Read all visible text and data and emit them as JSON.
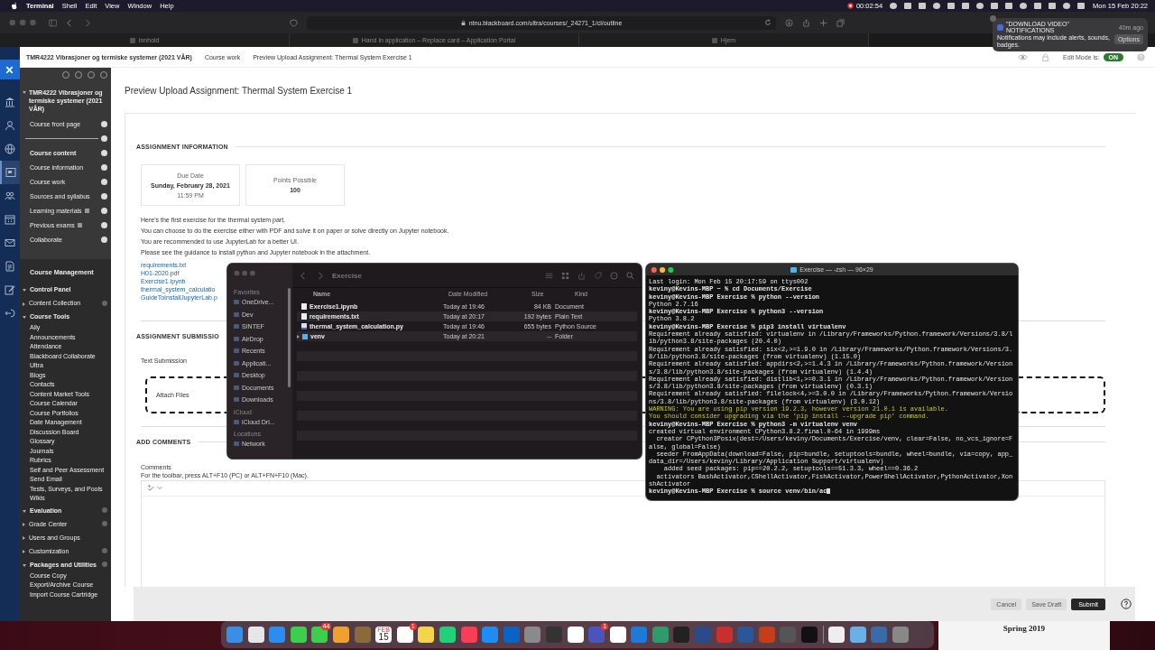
{
  "menubar": {
    "app": "Terminal",
    "menus": [
      "Shell",
      "Edit",
      "View",
      "Window",
      "Help"
    ],
    "recording_time": "00:02:54",
    "clock": "Mon 15 Feb 20:22"
  },
  "browser": {
    "url": "ntnu.blackboard.com/ultra/courses/_24271_1/cl/outline",
    "tabs": [
      "Innhold",
      "Hand in application – Replace card – Application Portal",
      "Hjem"
    ]
  },
  "notification": {
    "title": "\"DOWNLOAD VIDEO\" NOTIFICATIONS",
    "time": "40m ago",
    "body": "Notifications may include alerts, sounds, badges.",
    "action": "Options"
  },
  "header": {
    "breadcrumbs": [
      "TMR4222 Vibrasjoner og termiske systemer (2021 VÅR)",
      "Course work",
      "Preview Upload Assignment: Thermal System Exercise 1"
    ],
    "edit_mode_label": "Edit Mode is:",
    "edit_mode": {
      "on": true,
      "label": "ON"
    }
  },
  "course_menu": {
    "title": "TMR4222 Vibrasjoner og termiske systemer (2021 VÅR)",
    "items": [
      {
        "kind": "link",
        "label": "Course front page",
        "hidden": false
      },
      {
        "kind": "divider",
        "hidden": false
      },
      {
        "kind": "heading",
        "label": "Course content",
        "hidden": false
      },
      {
        "kind": "link",
        "label": "Course information",
        "hidden": false
      },
      {
        "kind": "link",
        "label": "Course work",
        "hidden": false
      },
      {
        "kind": "link",
        "label": "Sources and syllabus",
        "hidden": false
      },
      {
        "kind": "link",
        "label": "Learning materials",
        "hidden": true
      },
      {
        "kind": "link",
        "label": "Previous exams",
        "hidden": true
      },
      {
        "kind": "link",
        "label": "Collaborate",
        "hidden": false
      }
    ]
  },
  "course_management": {
    "title": "Course Management",
    "sections": [
      {
        "label": "Control Panel",
        "expanded": true,
        "menu": false,
        "children": [
          {
            "label": "Content Collection",
            "expanded": false,
            "menu": true
          },
          {
            "label": "Course Tools",
            "expanded": true,
            "menu": false,
            "children": [
              {
                "label": "Ally"
              },
              {
                "label": "Announcements"
              },
              {
                "label": "Attendance"
              },
              {
                "label": "Blackboard Collaborate Ultra"
              },
              {
                "label": "Blogs"
              },
              {
                "label": "Contacts"
              },
              {
                "label": "Content Market Tools"
              },
              {
                "label": "Course Calendar"
              },
              {
                "label": "Course Portfolios"
              },
              {
                "label": "Date Management"
              },
              {
                "label": "Discussion Board"
              },
              {
                "label": "Glossary"
              },
              {
                "label": "Journals"
              },
              {
                "label": "Rubrics"
              },
              {
                "label": "Self and Peer Assessment"
              },
              {
                "label": "Send Email"
              },
              {
                "label": "Tests, Surveys, and Pools"
              },
              {
                "label": "Wikis"
              }
            ]
          },
          {
            "label": "Evaluation",
            "expanded": true,
            "menu": true
          },
          {
            "label": "Grade Center",
            "expanded": false,
            "menu": true
          },
          {
            "label": "Users and Groups",
            "expanded": false,
            "menu": false
          },
          {
            "label": "Customization",
            "expanded": false,
            "menu": true
          },
          {
            "label": "Packages and Utilities",
            "expanded": true,
            "menu": true,
            "children": [
              {
                "label": "Course Copy"
              },
              {
                "label": "Export/Archive Course"
              },
              {
                "label": "Import Course Cartridge"
              }
            ]
          }
        ]
      }
    ]
  },
  "main": {
    "title": "Preview Upload Assignment: Thermal System Exercise 1",
    "info_heading": "ASSIGNMENT INFORMATION",
    "due": {
      "label": "Due Date",
      "date": "Sunday, February 28, 2021",
      "time": "11:59 PM"
    },
    "points": {
      "label": "Points Possible",
      "value": "100"
    },
    "instructions": [
      "Here's the first exercise for the thermal system part.",
      "You can choose to do the exercise either with PDF and solve it on paper or solve directly on Jupyter notebook.",
      "You are recommended to use JupyterLab for a better UI.",
      "Please see the guidance to install python and Jupyter notebook in the attachment."
    ],
    "attachments": [
      "requirements.txt",
      "H01-2020.pdf",
      "Exercise1.ipynb",
      "thermal_system_calculatio",
      "GuideToInstallJupyterLab.p"
    ],
    "submission_heading": "ASSIGNMENT SUBMISSIO",
    "text_submission": "Text Submission",
    "attach": "Attach Files",
    "comments_heading": "ADD COMMENTS",
    "comments_label": "Comments",
    "toolbar_hint": "For the toolbar, press ALT+F10 (PC) or ALT+FN+F10 (Mac).",
    "buttons": {
      "cancel": "Cancel",
      "save": "Save Draft",
      "submit": "Submit"
    }
  },
  "finder": {
    "title": "Exercise",
    "sidebar": [
      {
        "heading": "Favorites",
        "items": [
          "OneDrive...",
          "Dev",
          "SINTEF",
          "AirDrop",
          "Recents",
          "Applicati...",
          "Desktop",
          "Documents",
          "Downloads"
        ]
      },
      {
        "heading": "iCloud",
        "items": [
          "iCloud Dri..."
        ]
      },
      {
        "heading": "Locations",
        "items": [
          "Network"
        ]
      }
    ],
    "columns": [
      "Name",
      "Date Modified",
      "Size",
      "Kind"
    ],
    "rows": [
      {
        "kind": "document",
        "name": "Exercise1.ipynb",
        "date": "Today at 19:46",
        "size": "84 KB",
        "file_kind": "Document"
      },
      {
        "kind": "document",
        "name": "requirements.txt",
        "date": "Today at 20:17",
        "size": "192 bytes",
        "file_kind": "Plain Text"
      },
      {
        "kind": "python",
        "name": "thermal_system_calculation.py",
        "date": "Today at 19:46",
        "size": "655 bytes",
        "file_kind": "Python Source"
      },
      {
        "kind": "folder",
        "name": "venv",
        "date": "Today at 20:21",
        "size": "--",
        "file_kind": "Folder"
      }
    ]
  },
  "terminal": {
    "title": "Exercise — -zsh — 96×29",
    "lines": [
      {
        "kind": "output",
        "text": "Last login: Mon Feb 15 20:17:59 on ttys002"
      },
      {
        "kind": "prompt",
        "text": "keviny@Kevins-MBP ~ % cd Documents/Exercise"
      },
      {
        "kind": "prompt",
        "text": "keviny@Kevins-MBP Exercise % python --version"
      },
      {
        "kind": "output",
        "text": "Python 2.7.16"
      },
      {
        "kind": "prompt",
        "text": "keviny@Kevins-MBP Exercise % python3 --version"
      },
      {
        "kind": "output",
        "text": "Python 3.8.2"
      },
      {
        "kind": "prompt",
        "text": "keviny@Kevins-MBP Exercise % pip3 install virtualenv"
      },
      {
        "kind": "output",
        "text": "Requirement already satisfied: virtualenv in /Library/Frameworks/Python.framework/Versions/3.8/l"
      },
      {
        "kind": "output",
        "text": "ib/python3.8/site-packages (20.4.0)"
      },
      {
        "kind": "output",
        "text": "Requirement already satisfied: six<2,>=1.9.0 in /Library/Frameworks/Python.framework/Versions/3."
      },
      {
        "kind": "output",
        "text": "8/lib/python3.8/site-packages (from virtualenv) (1.15.0)"
      },
      {
        "kind": "output",
        "text": "Requirement already satisfied: appdirs<2,>=1.4.3 in /Library/Frameworks/Python.framework/Version"
      },
      {
        "kind": "output",
        "text": "s/3.8/lib/python3.8/site-packages (from virtualenv) (1.4.4)"
      },
      {
        "kind": "output",
        "text": "Requirement already satisfied: distlib<1,>=0.3.1 in /Library/Frameworks/Python.framework/Version"
      },
      {
        "kind": "output",
        "text": "s/3.8/lib/python3.8/site-packages (from virtualenv) (0.3.1)"
      },
      {
        "kind": "output",
        "text": "Requirement already satisfied: filelock<4,>=3.0.0 in /Library/Frameworks/Python.framework/Versio"
      },
      {
        "kind": "output",
        "text": "ns/3.8/lib/python3.8/site-packages (from virtualenv) (3.0.12)"
      },
      {
        "kind": "warning",
        "text": "WARNING: You are using pip version 19.2.3, however version 21.0.1 is available."
      },
      {
        "kind": "warning",
        "text": "You should consider upgrading via the 'pip install --upgrade pip' command."
      },
      {
        "kind": "prompt",
        "text": "keviny@Kevins-MBP Exercise % python3 -m virtualenv venv"
      },
      {
        "kind": "output",
        "text": "created virtual environment CPython3.8.2.final.0-64 in 1999ms"
      },
      {
        "kind": "output",
        "text": "  creator CPython3Posix(dest=/Users/keviny/Documents/Exercise/venv, clear=False, no_vcs_ignore=F"
      },
      {
        "kind": "output",
        "text": "alse, global=False)"
      },
      {
        "kind": "output",
        "text": "  seeder FromAppData(download=False, pip=bundle, setuptools=bundle, wheel=bundle, via=copy, app_"
      },
      {
        "kind": "output",
        "text": "data_dir=/Users/keviny/Library/Application Support/virtualenv)"
      },
      {
        "kind": "output",
        "text": "    added seed packages: pip==20.2.2, setuptools==51.3.3, wheel==0.36.2"
      },
      {
        "kind": "output",
        "text": "  activators BashActivator,CShellActivator,FishActivator,PowerShellActivator,PythonActivator,Xon"
      },
      {
        "kind": "output",
        "text": "shActivator"
      },
      {
        "kind": "input",
        "text": "keviny@Kevins-MBP Exercise % source venv/bin/ac"
      }
    ]
  },
  "dock": {
    "messages_badge": "44",
    "calendar_month": "FEB",
    "calendar_day": "15",
    "reminders_badge": "1",
    "teams_badge": "1"
  },
  "desktop": {
    "background_text": "Spring 2019"
  }
}
